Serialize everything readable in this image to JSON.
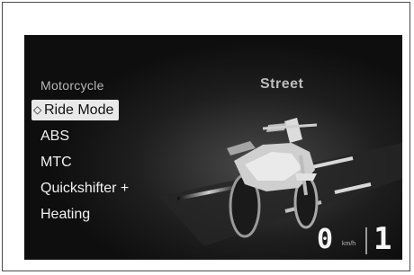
{
  "dashboard": {
    "menu_title": "Motorcycle",
    "ride_mode_value": "Street",
    "menu_items": [
      {
        "label": "Ride Mode",
        "selected": true
      },
      {
        "label": "ABS",
        "selected": false
      },
      {
        "label": "MTC",
        "selected": false
      },
      {
        "label": "Quickshifter +",
        "selected": false
      },
      {
        "label": "Heating",
        "selected": false
      }
    ],
    "speed": "0",
    "speed_unit": "km/h",
    "gear": "1"
  },
  "icons": {
    "selection_caret": "caret-icon",
    "motorcycle_image": "motorcycle-illustration"
  },
  "colors": {
    "screen_background": "#0e0e0e",
    "selected_item_background": "#e9e9e9",
    "text": "#f2f2f2"
  }
}
